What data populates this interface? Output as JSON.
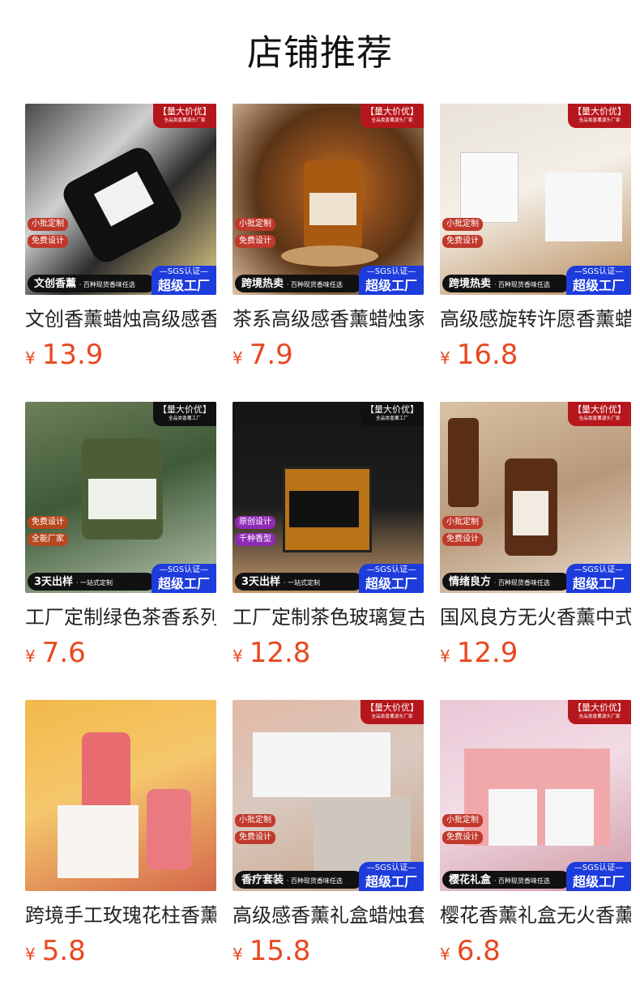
{
  "page": {
    "title": "店铺推荐"
  },
  "colors": {
    "price": "#e8481f",
    "sgs": "#1e3cdc",
    "badge_red": "#b6171d",
    "badge_black": "#111111"
  },
  "products": [
    {
      "name": "文创香薰蜡烛高级感香薰",
      "currency": "¥",
      "price": "13.9",
      "badge": {
        "title": "【量大价优】",
        "sub": "全品类香薰源头厂家",
        "style": "red"
      },
      "tags": [
        "小批定制",
        "免费设计"
      ],
      "tag_color": "#c0392b",
      "bottom": {
        "bold": "文创香薰",
        "small": "· 百种现货香味任选"
      },
      "sgs": {
        "top": "SGS认证",
        "main": "超级工厂"
      }
    },
    {
      "name": "茶系高级感香薰蜡烛家用",
      "currency": "¥",
      "price": "7.9",
      "badge": {
        "title": "【量大价优】",
        "sub": "全品类香薰源头厂家",
        "style": "red"
      },
      "tags": [
        "小批定制",
        "免费设计"
      ],
      "tag_color": "#c0392b",
      "bottom": {
        "bold": "跨境热卖",
        "small": "· 百种现货香味任选"
      },
      "sgs": {
        "top": "SGS认证",
        "main": "超级工厂"
      }
    },
    {
      "name": "高级感旋转许愿香薰蜡烛",
      "currency": "¥",
      "price": "16.8",
      "badge": {
        "title": "【量大价优】",
        "sub": "全品类香薰源头厂家",
        "style": "red"
      },
      "tags": [
        "小批定制",
        "免费设计"
      ],
      "tag_color": "#c0392b",
      "bottom": {
        "bold": "跨境热卖",
        "small": "· 百种现货香味任选"
      },
      "sgs": {
        "top": "SGS认证",
        "main": "超级工厂"
      }
    },
    {
      "name": "工厂定制绿色茶香系列蜡烛",
      "currency": "¥",
      "price": "7.6",
      "badge": {
        "title": "【量大价优】",
        "sub": "全品类香薰工厂",
        "style": "black"
      },
      "tags": [
        "免费设计",
        "全能厂家"
      ],
      "tag_color": "#b5481e",
      "bottom": {
        "bold": "3天出样",
        "small": "· 一站式定制"
      },
      "sgs": {
        "top": "SGS认证",
        "main": "超级工厂"
      }
    },
    {
      "name": "工厂定制茶色玻璃复古蜡烛",
      "currency": "¥",
      "price": "12.8",
      "badge": {
        "title": "【量大价优】",
        "sub": "全品类香薰工厂",
        "style": "black"
      },
      "tags": [
        "原创设计",
        "千种香型"
      ],
      "tag_color": "#8e2bb5",
      "bottom": {
        "bold": "3天出样",
        "small": "· 一站式定制"
      },
      "sgs": {
        "top": "SGS认证",
        "main": "超级工厂"
      }
    },
    {
      "name": "国风良方无火香薰中式礼盒",
      "currency": "¥",
      "price": "12.9",
      "badge": {
        "title": "【量大价优】",
        "sub": "全品类香薰源头厂家",
        "style": "red"
      },
      "tags": [
        "小批定制",
        "免费设计"
      ],
      "tag_color": "#c0392b",
      "bottom": {
        "bold": "情绪良方",
        "small": "· 百种现货香味任选"
      },
      "sgs": {
        "top": "SGS认证",
        "main": "超级工厂"
      }
    },
    {
      "name": "跨境手工玫瑰花柱香薰蜡烛",
      "currency": "¥",
      "price": "5.8",
      "badge": null,
      "tags": [],
      "tag_color": "#c0392b",
      "bottom": null,
      "sgs": null
    },
    {
      "name": "高级感香薰礼盒蜡烛套装",
      "currency": "¥",
      "price": "15.8",
      "badge": {
        "title": "【量大价优】",
        "sub": "全品类香薰源头厂家",
        "style": "red"
      },
      "tags": [
        "小批定制",
        "免费设计"
      ],
      "tag_color": "#c0392b",
      "bottom": {
        "bold": "香疗套装",
        "small": "· 百种现货香味任选"
      },
      "sgs": {
        "top": "SGS认证",
        "main": "超级工厂"
      }
    },
    {
      "name": "樱花香薰礼盒无火香薰套装",
      "currency": "¥",
      "price": "6.8",
      "badge": {
        "title": "【量大价优】",
        "sub": "全品类香薰源头厂家",
        "style": "red"
      },
      "tags": [
        "小批定制",
        "免费设计"
      ],
      "tag_color": "#c0392b",
      "bottom": {
        "bold": "樱花礼盒",
        "small": "· 百种现货香味任选"
      },
      "sgs": {
        "top": "SGS认证",
        "main": "超级工厂"
      }
    }
  ]
}
